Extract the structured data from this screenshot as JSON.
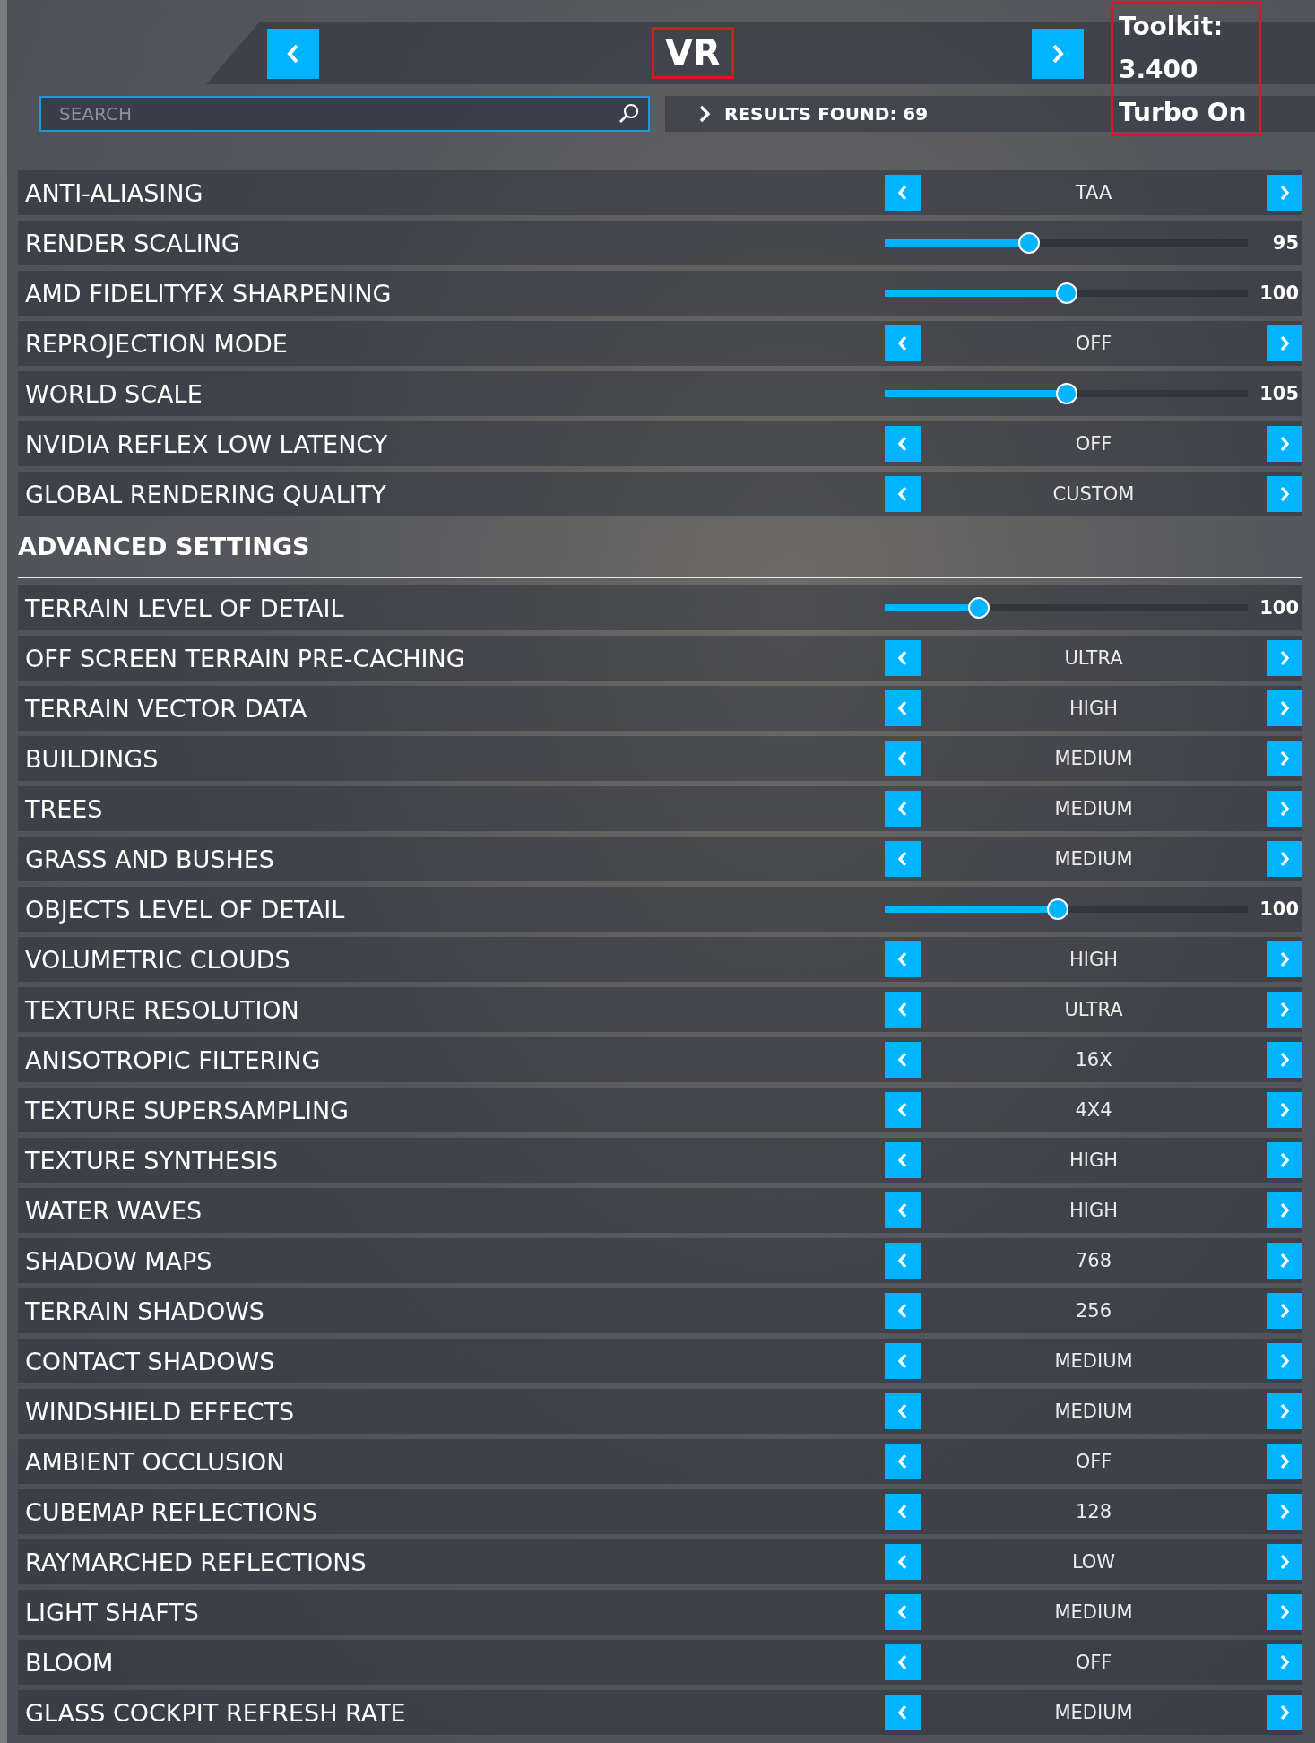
{
  "header": {
    "title": "VR",
    "search": {
      "placeholder": "SEARCH"
    },
    "results": "RESULTS FOUND: 69"
  },
  "annotation": {
    "lines": [
      "Toolkit:",
      "3.400",
      "Turbo On"
    ]
  },
  "settings": [
    {
      "kind": "choice",
      "label": "ANTI-ALIASING",
      "value": "TAA"
    },
    {
      "kind": "slider",
      "label": "RENDER SCALING",
      "level": 0.39,
      "reading": "95"
    },
    {
      "kind": "slider",
      "label": "AMD FIDELITYFX SHARPENING",
      "level": 0.5,
      "reading": "100"
    },
    {
      "kind": "choice",
      "label": "REPROJECTION MODE",
      "value": "OFF"
    },
    {
      "kind": "slider",
      "label": "WORLD SCALE",
      "level": 0.5,
      "reading": "105"
    },
    {
      "kind": "choice",
      "label": "NVIDIA REFLEX LOW LATENCY",
      "value": "OFF"
    },
    {
      "kind": "choice",
      "label": "GLOBAL RENDERING QUALITY",
      "value": "CUSTOM"
    }
  ],
  "advanced": {
    "title": "ADVANCED SETTINGS",
    "settings": [
      {
        "kind": "slider",
        "label": "TERRAIN LEVEL OF DETAIL",
        "level": 0.245,
        "reading": "100"
      },
      {
        "kind": "choice",
        "label": "OFF SCREEN TERRAIN PRE-CACHING",
        "value": "ULTRA"
      },
      {
        "kind": "choice",
        "label": "TERRAIN VECTOR DATA",
        "value": "HIGH"
      },
      {
        "kind": "choice",
        "label": "BUILDINGS",
        "value": "MEDIUM"
      },
      {
        "kind": "choice",
        "label": "TREES",
        "value": "MEDIUM"
      },
      {
        "kind": "choice",
        "label": "GRASS AND BUSHES",
        "value": "MEDIUM"
      },
      {
        "kind": "slider",
        "label": "OBJECTS LEVEL OF DETAIL",
        "level": 0.475,
        "reading": "100"
      },
      {
        "kind": "choice",
        "label": "VOLUMETRIC CLOUDS",
        "value": "HIGH"
      },
      {
        "kind": "choice",
        "label": "TEXTURE RESOLUTION",
        "value": "ULTRA"
      },
      {
        "kind": "choice",
        "label": "ANISOTROPIC FILTERING",
        "value": "16X"
      },
      {
        "kind": "choice",
        "label": "TEXTURE SUPERSAMPLING",
        "value": "4X4"
      },
      {
        "kind": "choice",
        "label": "TEXTURE SYNTHESIS",
        "value": "HIGH"
      },
      {
        "kind": "choice",
        "label": "WATER WAVES",
        "value": "HIGH"
      },
      {
        "kind": "choice",
        "label": "SHADOW MAPS",
        "value": "768"
      },
      {
        "kind": "choice",
        "label": "TERRAIN SHADOWS",
        "value": "256"
      },
      {
        "kind": "choice",
        "label": "CONTACT SHADOWS",
        "value": "MEDIUM"
      },
      {
        "kind": "choice",
        "label": "WINDSHIELD EFFECTS",
        "value": "MEDIUM"
      },
      {
        "kind": "choice",
        "label": "AMBIENT OCCLUSION",
        "value": "OFF"
      },
      {
        "kind": "choice",
        "label": "CUBEMAP REFLECTIONS",
        "value": "128"
      },
      {
        "kind": "choice",
        "label": "RAYMARCHED REFLECTIONS",
        "value": "LOW"
      },
      {
        "kind": "choice",
        "label": "LIGHT SHAFTS",
        "value": "MEDIUM"
      },
      {
        "kind": "choice",
        "label": "BLOOM",
        "value": "OFF"
      },
      {
        "kind": "choice",
        "label": "GLASS COCKPIT REFRESH RATE",
        "value": "MEDIUM"
      }
    ]
  }
}
